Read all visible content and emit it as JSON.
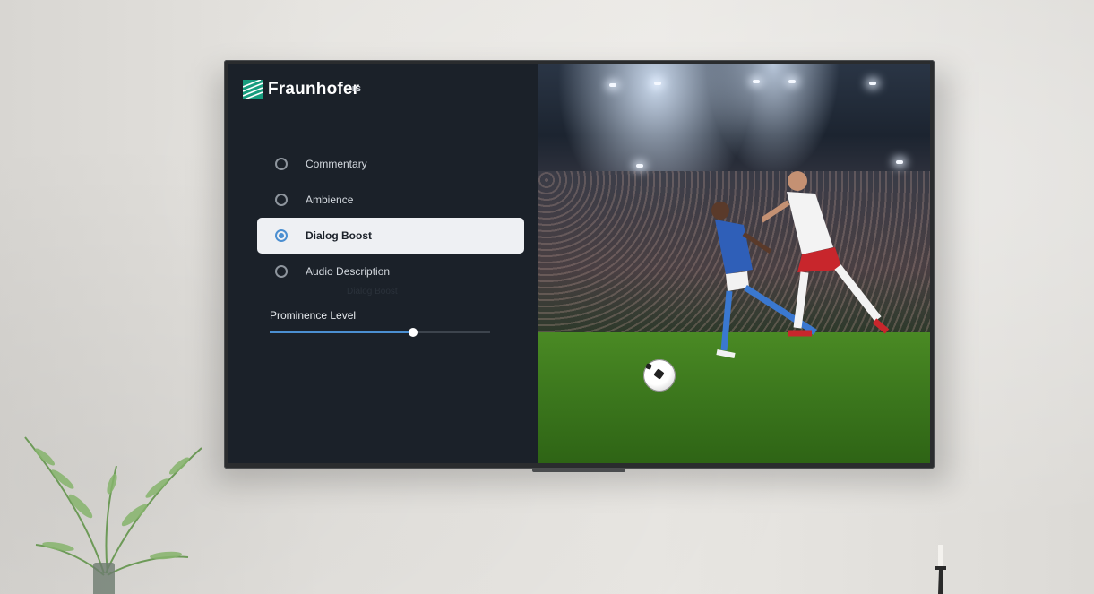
{
  "brand": {
    "name": "Fraunhofer",
    "sub": "IIS",
    "logo_icon": "fraunhofer-stripes-icon",
    "color": "#179c7d"
  },
  "menu": {
    "options": [
      {
        "label": "Commentary",
        "selected": false
      },
      {
        "label": "Ambience",
        "selected": false
      },
      {
        "label": "Dialog Boost",
        "selected": true
      },
      {
        "label": "Audio Description",
        "selected": false
      }
    ],
    "ghost_label": "Dialog Boost",
    "prominence": {
      "label": "Prominence Level",
      "value": 0.65
    }
  },
  "colors": {
    "panel_bg": "#1b2129",
    "accent": "#4b8fd1",
    "selected_bg": "#eef0f3"
  }
}
